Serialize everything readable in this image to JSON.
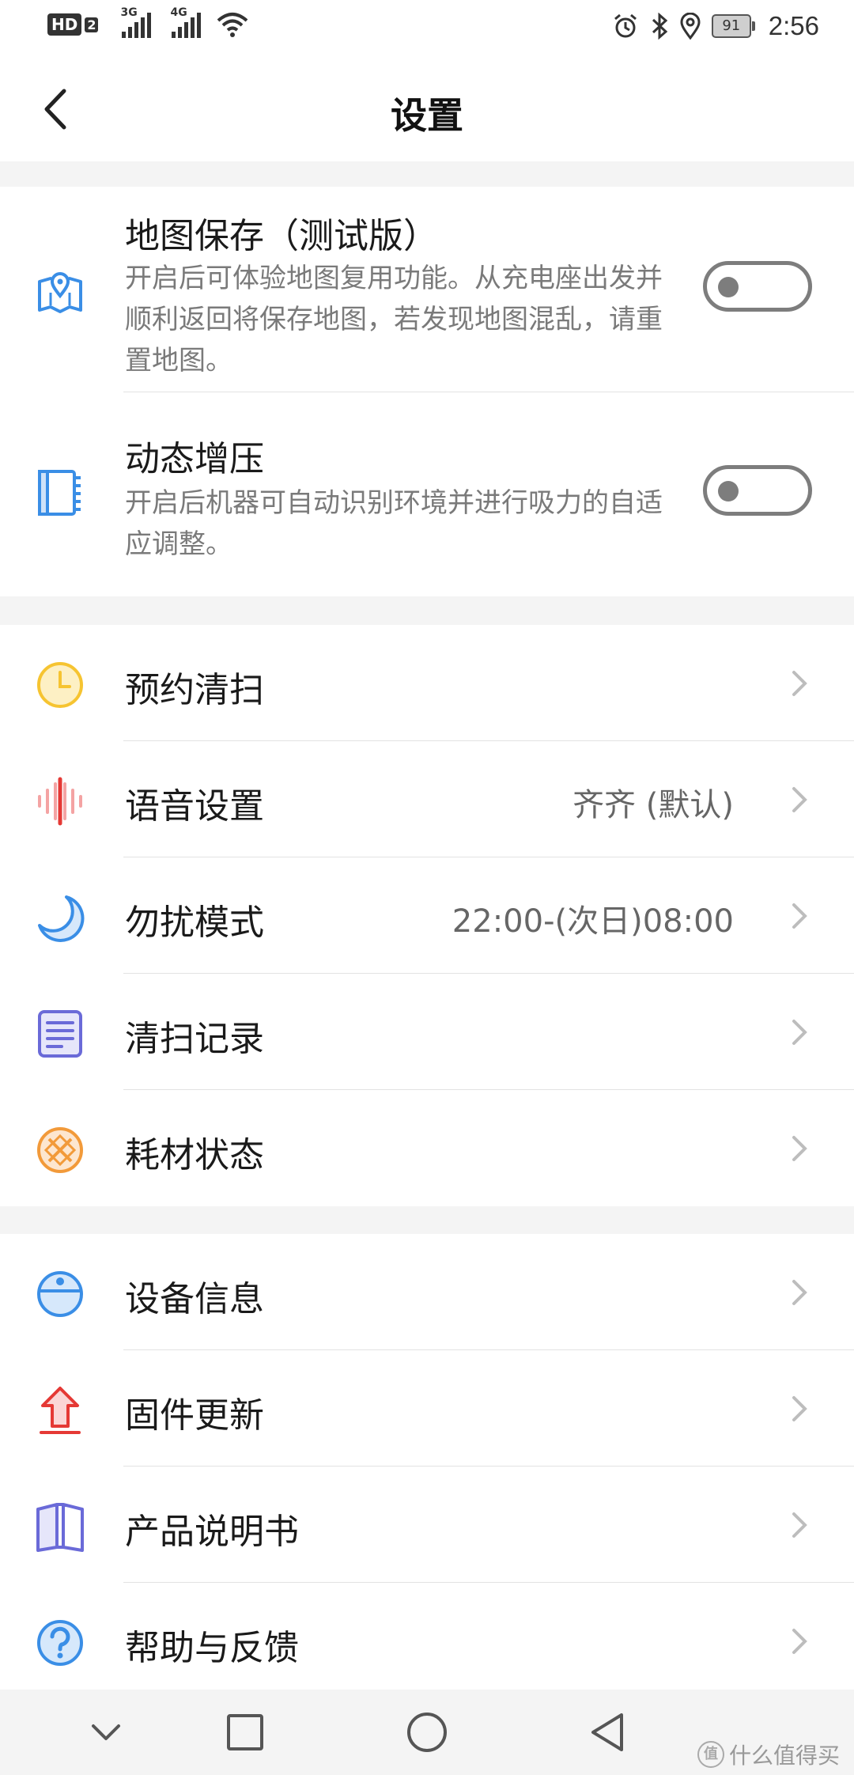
{
  "status_bar": {
    "hd_label": "HD",
    "hd_sub": "2",
    "signal1_gen": "3G",
    "signal2_gen": "4G",
    "battery": "91",
    "time": "2:56"
  },
  "header": {
    "title": "设置"
  },
  "toggle_section": [
    {
      "title": "地图保存（测试版）",
      "description": "开启后可体验地图复用功能。从充电座出发并顺利返回将保存地图，若发现地图混乱，请重置地图。",
      "enabled": false
    },
    {
      "title": "动态增压",
      "description": "开启后机器可自动识别环境并进行吸力的自适应调整。",
      "enabled": false
    }
  ],
  "menu_section": [
    {
      "label": "预约清扫",
      "value": "",
      "icon": "clock-icon",
      "color": "#f6c431"
    },
    {
      "label": "语音设置",
      "value": "齐齐 (默认)",
      "icon": "sound-wave-icon",
      "color": "#e53935"
    },
    {
      "label": "勿扰模式",
      "value": "22:00-(次日)08:00",
      "icon": "moon-icon",
      "color": "#3a8ee6"
    },
    {
      "label": "清扫记录",
      "value": "",
      "icon": "notepad-icon",
      "color": "#6a6ad8"
    },
    {
      "label": "耗材状态",
      "value": "",
      "icon": "filter-icon",
      "color": "#f29a3a"
    }
  ],
  "info_section": [
    {
      "label": "设备信息",
      "value": "",
      "icon": "robot-device-icon",
      "color": "#3a8ee6"
    },
    {
      "label": "固件更新",
      "value": "",
      "icon": "upload-arrow-icon",
      "color": "#e53935"
    },
    {
      "label": "产品说明书",
      "value": "",
      "icon": "book-icon",
      "color": "#6a6ad8"
    },
    {
      "label": "帮助与反馈",
      "value": "",
      "icon": "question-icon",
      "color": "#3a8ee6"
    }
  ],
  "watermark": "什么值得买",
  "watermark_logo": "值"
}
